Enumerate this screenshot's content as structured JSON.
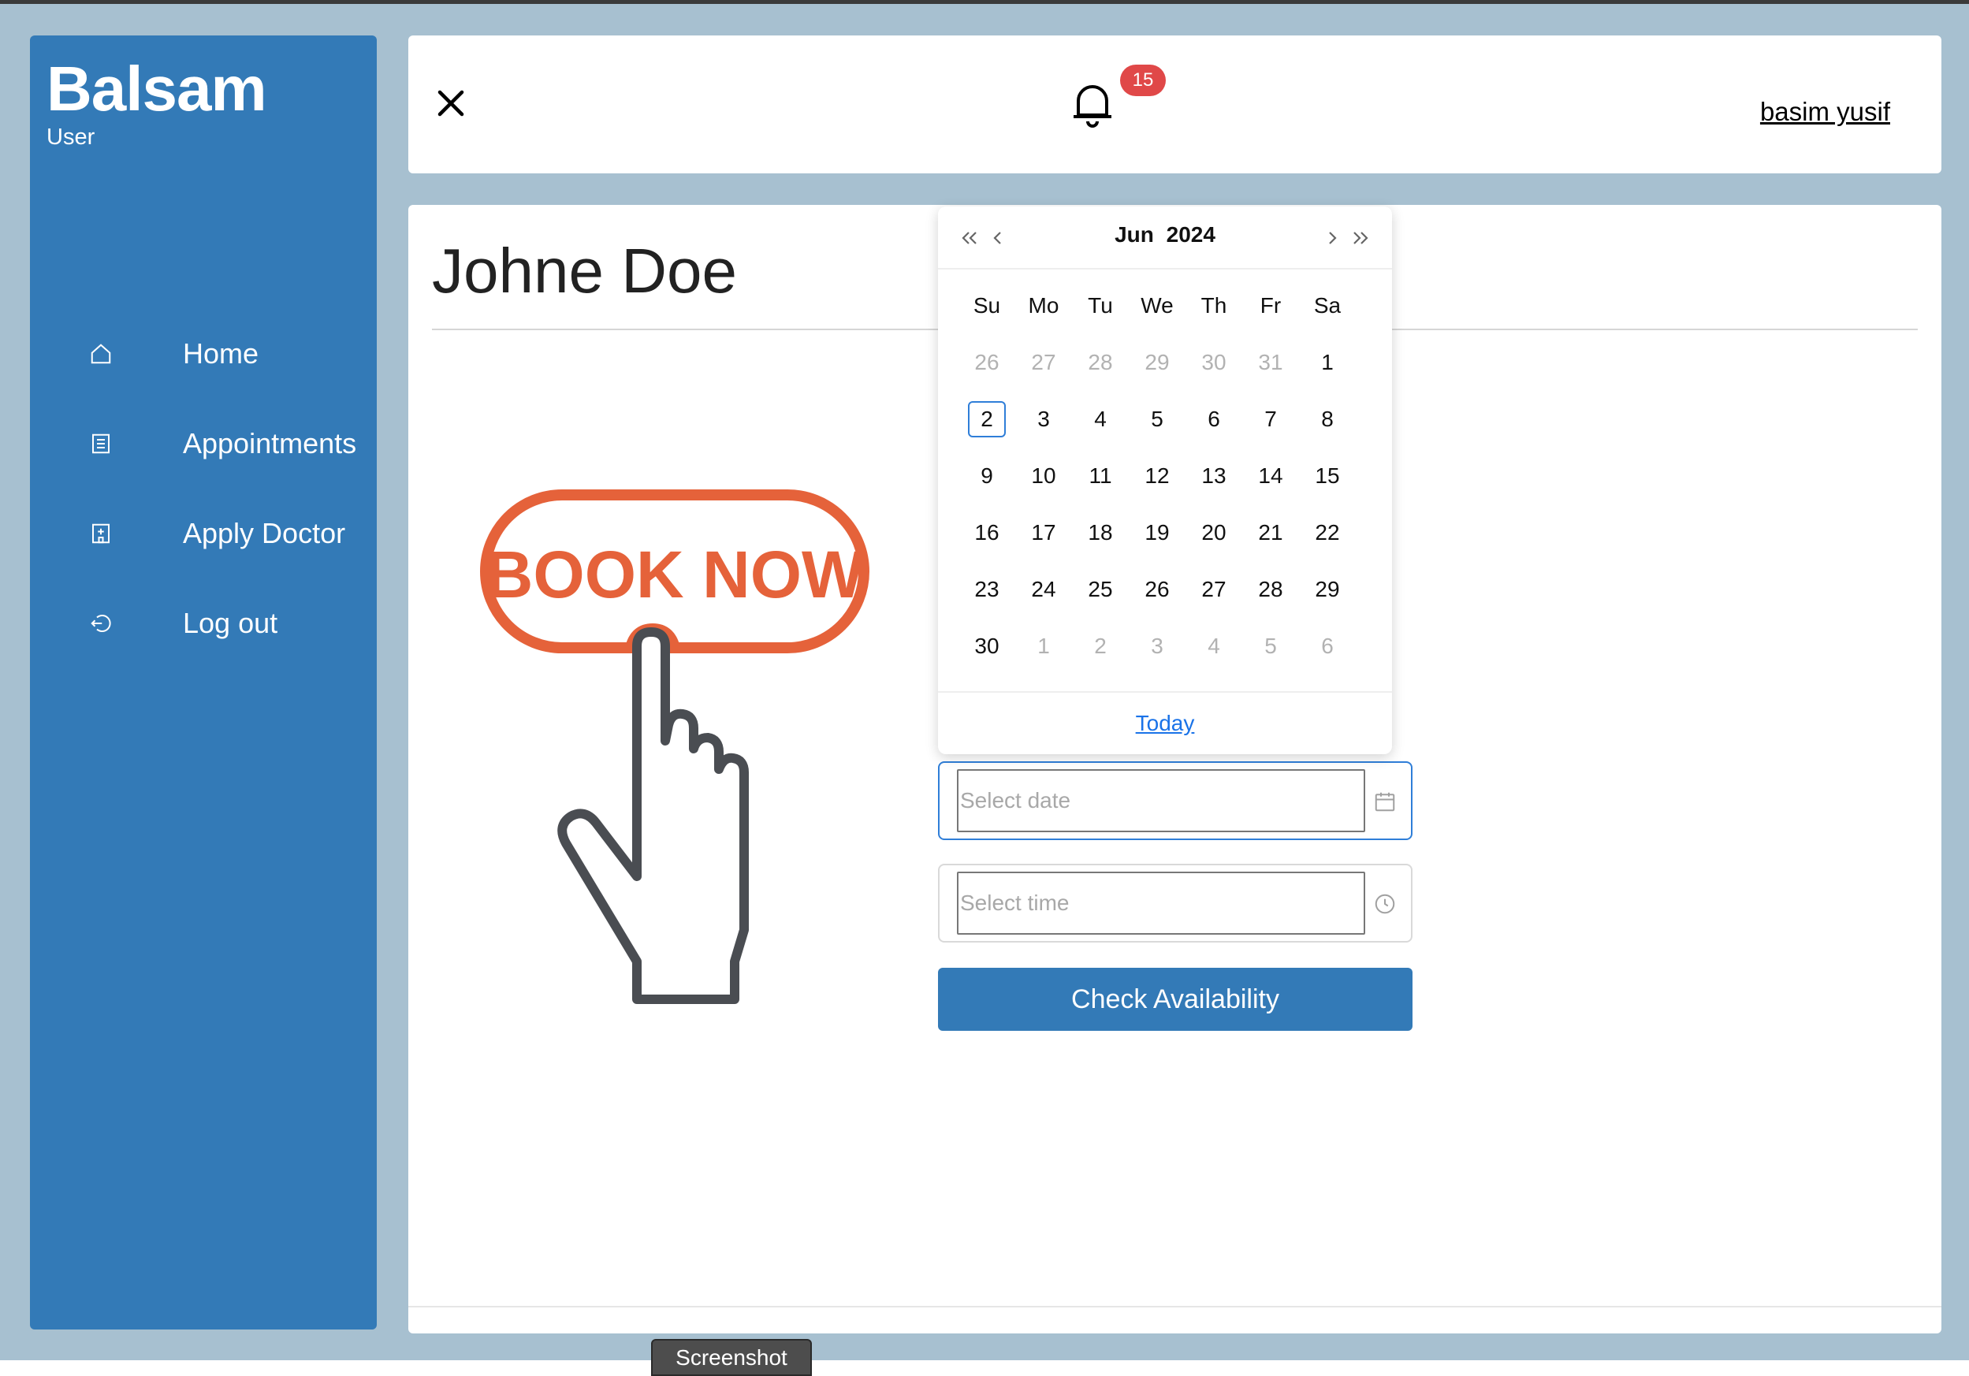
{
  "sidebar": {
    "brand": "Balsam",
    "role": "User",
    "items": [
      {
        "label": "Home",
        "icon": "home-icon"
      },
      {
        "label": "Appointments",
        "icon": "document-icon"
      },
      {
        "label": "Apply Doctor",
        "icon": "hospital-icon"
      },
      {
        "label": "Log out",
        "icon": "logout-icon"
      }
    ]
  },
  "header": {
    "notification_count": "15",
    "username": "basim yusif"
  },
  "main": {
    "doctor_name": "Johne Doe",
    "illustration_text": "BOOK NOW",
    "date_field": {
      "placeholder": "Select date",
      "value": ""
    },
    "time_field": {
      "placeholder": "Select time",
      "value": ""
    },
    "check_button": "Check Availability"
  },
  "calendar": {
    "month": "Jun",
    "year": "2024",
    "weekdays": [
      "Su",
      "Mo",
      "Tu",
      "We",
      "Th",
      "Fr",
      "Sa"
    ],
    "weeks": [
      [
        "26",
        "27",
        "28",
        "29",
        "30",
        "31",
        "1"
      ],
      [
        "2",
        "3",
        "4",
        "5",
        "6",
        "7",
        "8"
      ],
      [
        "9",
        "10",
        "11",
        "12",
        "13",
        "14",
        "15"
      ],
      [
        "16",
        "17",
        "18",
        "19",
        "20",
        "21",
        "22"
      ],
      [
        "23",
        "24",
        "25",
        "26",
        "27",
        "28",
        "29"
      ],
      [
        "30",
        "1",
        "2",
        "3",
        "4",
        "5",
        "6"
      ]
    ],
    "selected_day": "2",
    "today_label": "Today"
  },
  "overlay": {
    "tooltip": "Screenshot"
  },
  "colors": {
    "primary": "#337ab7",
    "background": "#a7c0d0",
    "badge": "#e04848",
    "book_now_orange": "#e5623a",
    "link": "#1a73e8"
  }
}
